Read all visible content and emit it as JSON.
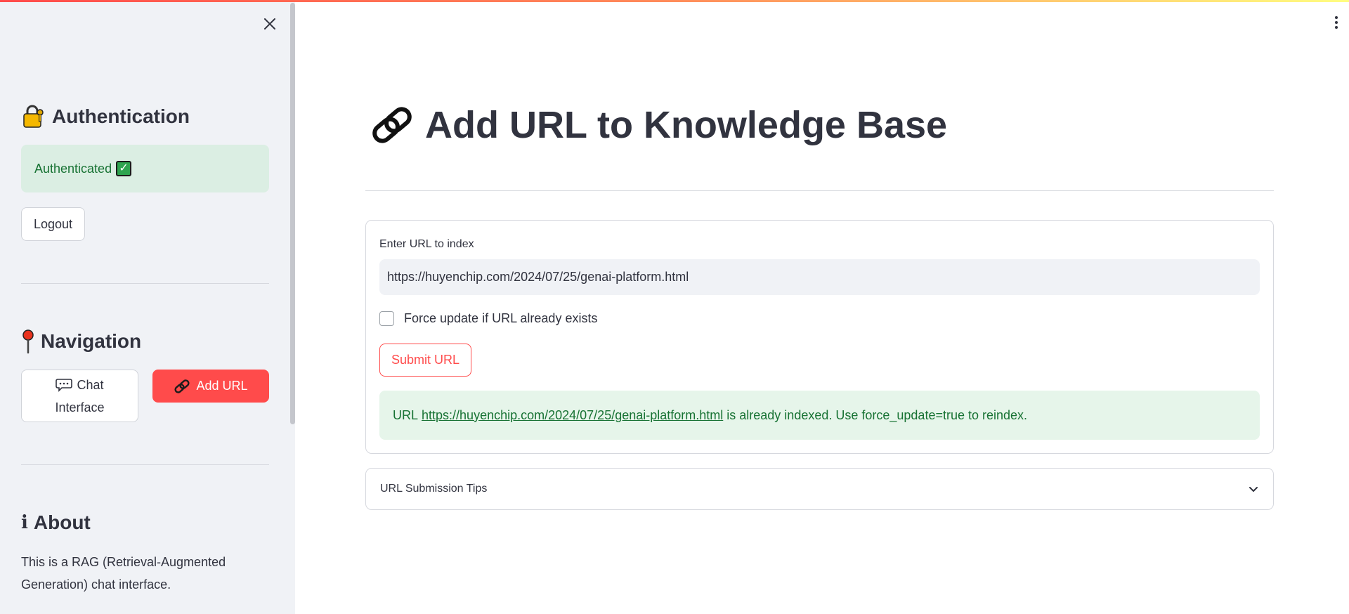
{
  "sidebar": {
    "auth_heading": "Authentication",
    "auth_status": "Authenticated",
    "logout_label": "Logout",
    "nav_heading": "Navigation",
    "nav_chat_line1": "Chat",
    "nav_chat_line2": "Interface",
    "nav_add_url": "Add URL",
    "about_heading": "About",
    "about_text": "This is a RAG (Retrieval-Augmented Generation) chat interface."
  },
  "main": {
    "title": "Add URL to Knowledge Base",
    "form": {
      "label": "Enter URL to index",
      "url_value": "https://huyenchip.com/2024/07/25/genai-platform.html",
      "checkbox_label": "Force update if URL already exists",
      "checkbox_checked": false,
      "submit_label": "Submit URL"
    },
    "message": {
      "prefix": "URL",
      "link": "https://huyenchip.com/2024/07/25/genai-platform.html",
      "suffix": "is already indexed. Use force_update=true to reindex."
    },
    "tips_label": "URL Submission Tips"
  },
  "colors": {
    "accent": "#ff4b4b",
    "success_text": "#177233",
    "success_bg": "#dbeee3",
    "sidebar_bg": "#f0f2f6"
  },
  "icons": {
    "close": "close-icon",
    "menu": "more-vertical-icon",
    "auth": "locked-with-key-icon",
    "nav": "round-pushpin-icon",
    "chat": "speech-balloon-icon",
    "link": "link-icon",
    "info": "info-icon",
    "chevron": "chevron-down-icon"
  }
}
